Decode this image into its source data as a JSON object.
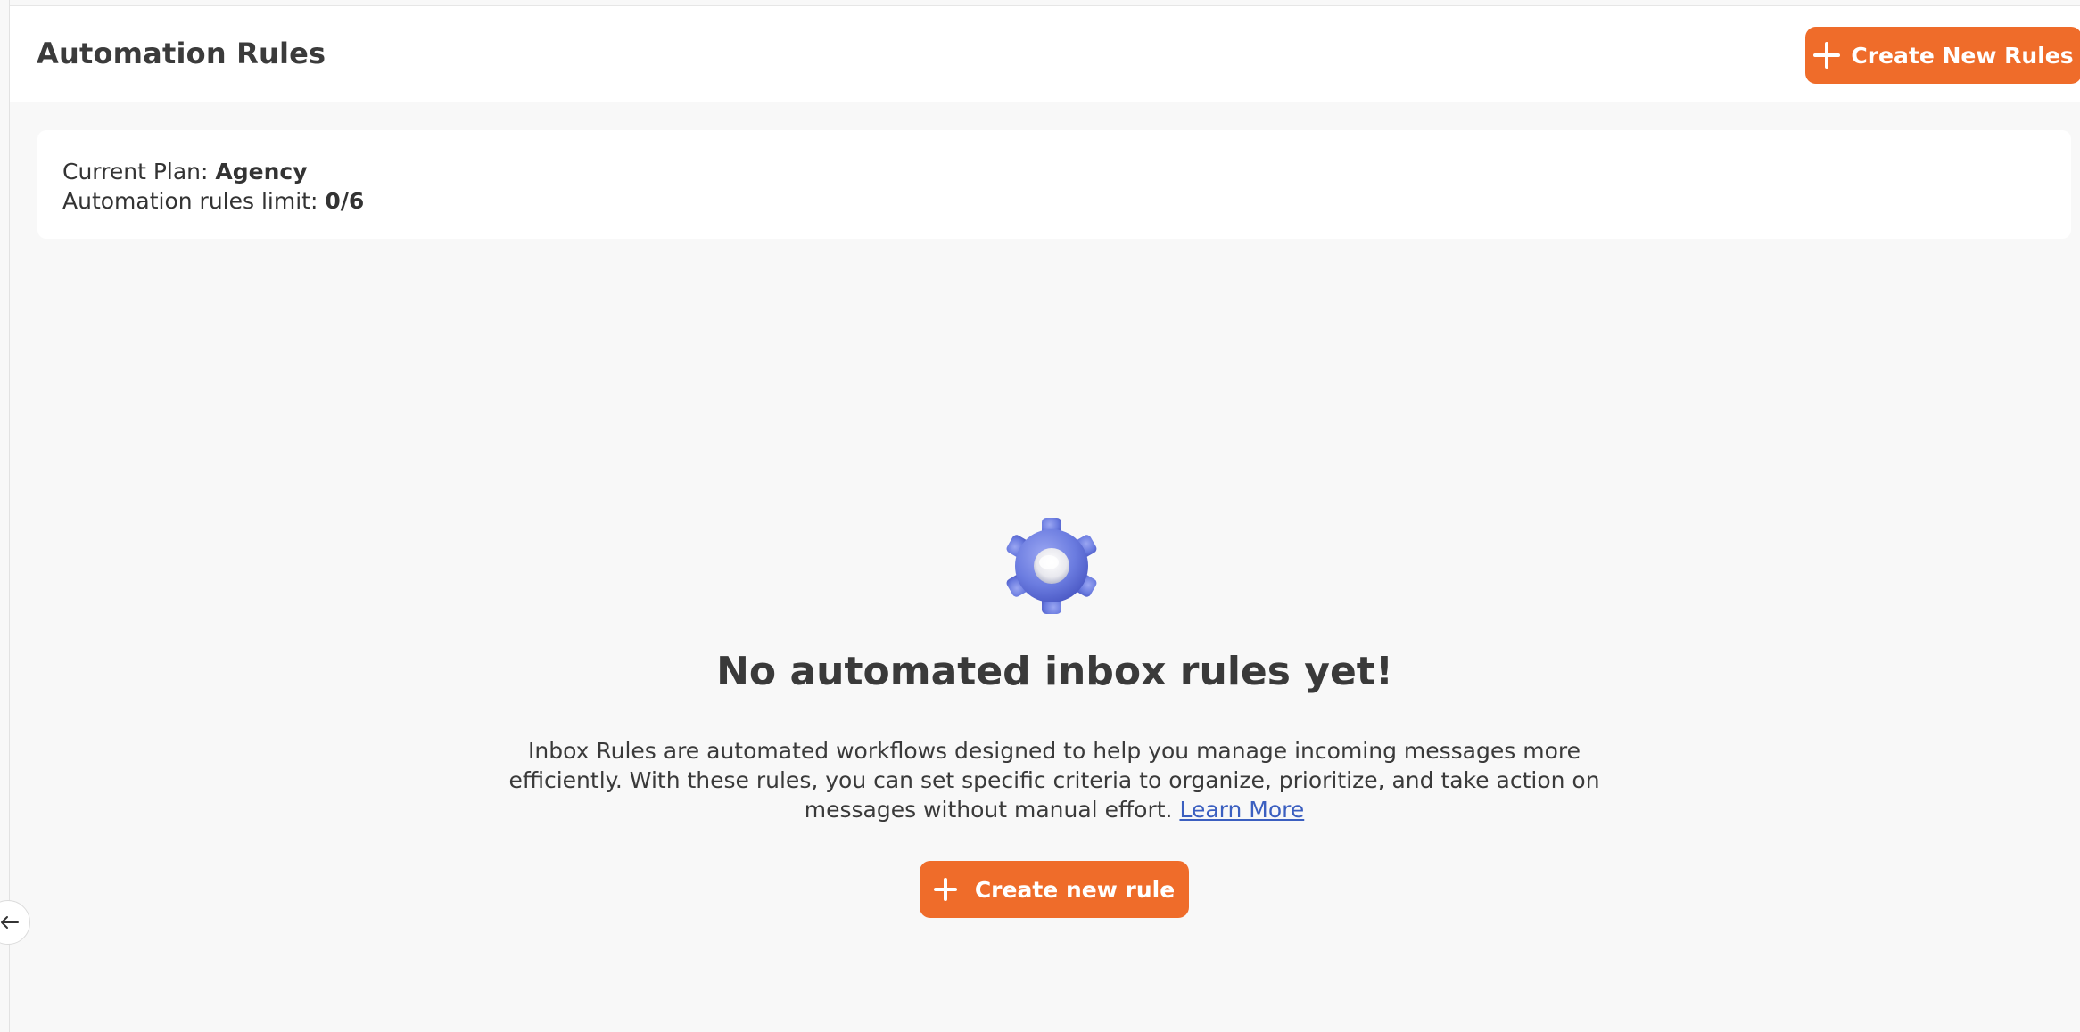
{
  "header": {
    "title": "Automation Rules",
    "create_button_label": "Create New Rules"
  },
  "plan": {
    "plan_label": "Current Plan: ",
    "plan_value": "Agency",
    "limit_label": "Automation rules limit: ",
    "limit_value": "0/6"
  },
  "empty_state": {
    "icon": "gear-icon",
    "title": "No automated inbox rules yet!",
    "description": "Inbox Rules are automated workflows designed to help you manage incoming messages more efficiently. With these rules, you can set specific criteria to organize, prioritize, and take action on messages without manual effort.",
    "learn_more": "Learn More",
    "create_button_label": "Create new rule"
  },
  "sidebar": {
    "collapse_icon": "arrow-left-icon"
  },
  "colors": {
    "accent": "#ef6c2a",
    "link": "#3b5fc0",
    "gear": "#6b7ce0"
  }
}
